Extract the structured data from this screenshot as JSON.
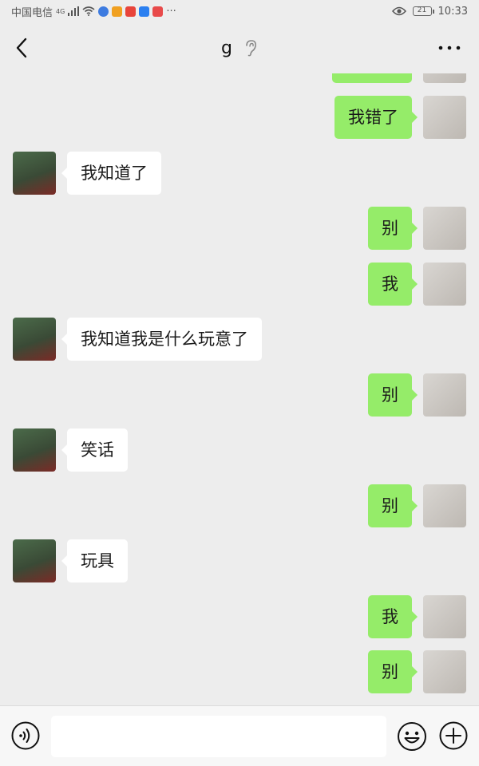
{
  "status_bar": {
    "carrier": "中国电信",
    "network": "4G",
    "time": "10:33",
    "battery": "21",
    "overflow": "···",
    "app_icon_colors": [
      "#3d7be0",
      "#f0a020",
      "#e8443a",
      "#2a7ff0",
      "#e84a4a"
    ]
  },
  "header": {
    "title": "g",
    "back_icon": "chevron-left-icon",
    "mode_icon": "ear-icon",
    "more_icon": "more-dots-icon"
  },
  "colors": {
    "background": "#ededed",
    "own_bubble": "#95ec69",
    "other_bubble": "#ffffff"
  },
  "messages": [
    {
      "side": "right",
      "text": ""
    },
    {
      "side": "right",
      "text": "我错了"
    },
    {
      "side": "left",
      "text": "我知道了"
    },
    {
      "side": "right",
      "text": "别"
    },
    {
      "side": "right",
      "text": "我"
    },
    {
      "side": "left",
      "text": "我知道我是什么玩意了"
    },
    {
      "side": "right",
      "text": "别"
    },
    {
      "side": "left",
      "text": "笑话"
    },
    {
      "side": "right",
      "text": "别"
    },
    {
      "side": "left",
      "text": "玩具"
    },
    {
      "side": "right",
      "text": "我"
    },
    {
      "side": "right",
      "text": "别"
    }
  ],
  "input_bar": {
    "voice_icon": "voice-icon",
    "input_value": "",
    "emoji_icon": "emoji-icon",
    "plus_icon": "plus-icon"
  }
}
